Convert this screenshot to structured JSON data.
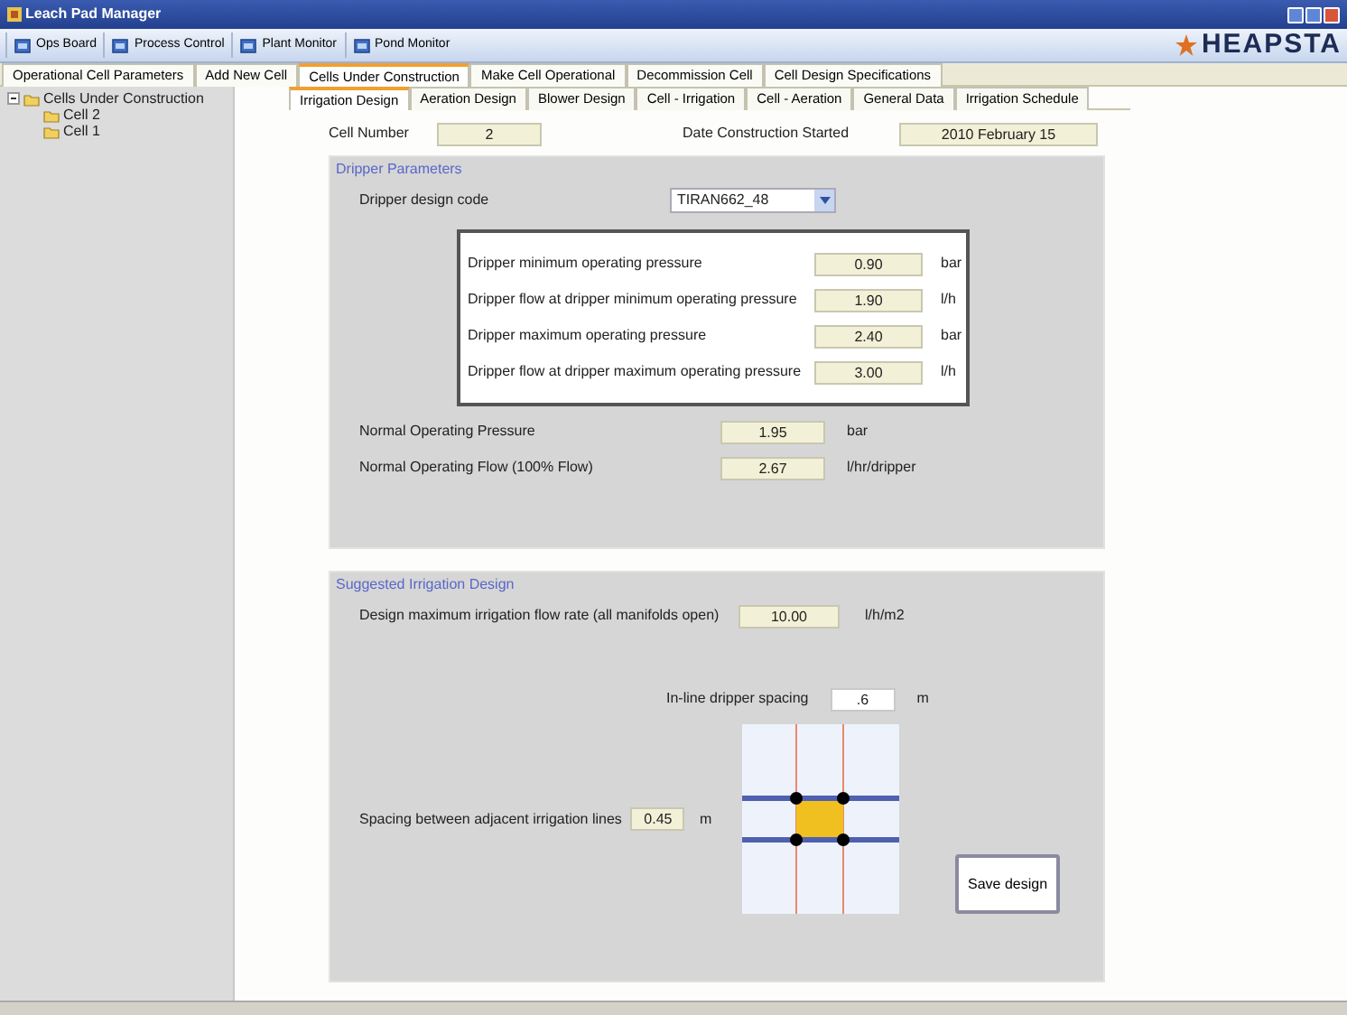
{
  "window": {
    "title": "Leach Pad Manager"
  },
  "toolbar": [
    {
      "label": "Ops Board"
    },
    {
      "label": "Process Control"
    },
    {
      "label": "Plant Monitor"
    },
    {
      "label": "Pond Monitor"
    }
  ],
  "logo": {
    "text": "HEAPSTA"
  },
  "main_tabs": [
    {
      "label": "Operational Cell Parameters",
      "selected": false
    },
    {
      "label": "Add New Cell",
      "selected": false
    },
    {
      "label": "Cells Under Construction",
      "selected": true
    },
    {
      "label": "Make Cell Operational",
      "selected": false
    },
    {
      "label": "Decommission Cell",
      "selected": false
    },
    {
      "label": "Cell Design Specifications",
      "selected": false
    }
  ],
  "tree": {
    "label": "Cells Under Construction",
    "expanded": true,
    "children": [
      {
        "label": "Cell 2"
      },
      {
        "label": "Cell 1"
      }
    ]
  },
  "sub_tabs": [
    {
      "label": "Irrigation Design",
      "selected": true
    },
    {
      "label": "Aeration Design",
      "selected": false
    },
    {
      "label": "Blower Design",
      "selected": false
    },
    {
      "label": "Cell - Irrigation",
      "selected": false
    },
    {
      "label": "Cell - Aeration",
      "selected": false
    },
    {
      "label": "General Data",
      "selected": false
    },
    {
      "label": "Irrigation Schedule",
      "selected": false
    }
  ],
  "cell_number": {
    "label": "Cell Number",
    "value": "2"
  },
  "date_started": {
    "label": "Date Construction Started",
    "value": "2010 February 15"
  },
  "dripper_parameters": {
    "title": "Dripper Parameters",
    "design_code": {
      "label": "Dripper design code",
      "value": "TIRAN662_48"
    },
    "specs": [
      {
        "label": "Dripper minimum operating pressure",
        "value": "0.90",
        "unit": "bar"
      },
      {
        "label": "Dripper flow at dripper minimum operating pressure",
        "value": "1.90",
        "unit": "l/h"
      },
      {
        "label": "Dripper maximum operating pressure",
        "value": "2.40",
        "unit": "bar"
      },
      {
        "label": "Dripper flow at dripper maximum operating pressure",
        "value": "3.00",
        "unit": "l/h"
      }
    ],
    "normal": [
      {
        "label": "Normal Operating Pressure",
        "value": "1.95",
        "unit": "bar"
      },
      {
        "label": "Normal Operating Flow (100% Flow)",
        "value": "2.67",
        "unit": "l/hr/dripper"
      }
    ]
  },
  "irrigation_design": {
    "title": "Suggested Irrigation Design",
    "max_flow": {
      "label": "Design maximum irrigation flow rate (all manifolds open)",
      "value": "10.00",
      "unit": "l/h/m2"
    },
    "inline_spacing": {
      "label": "In-line dripper spacing",
      "value": ".6",
      "unit": "m"
    },
    "line_spacing": {
      "label": "Spacing between adjacent irrigation lines",
      "value": "0.45",
      "unit": "m"
    },
    "save_button": "Save design"
  }
}
